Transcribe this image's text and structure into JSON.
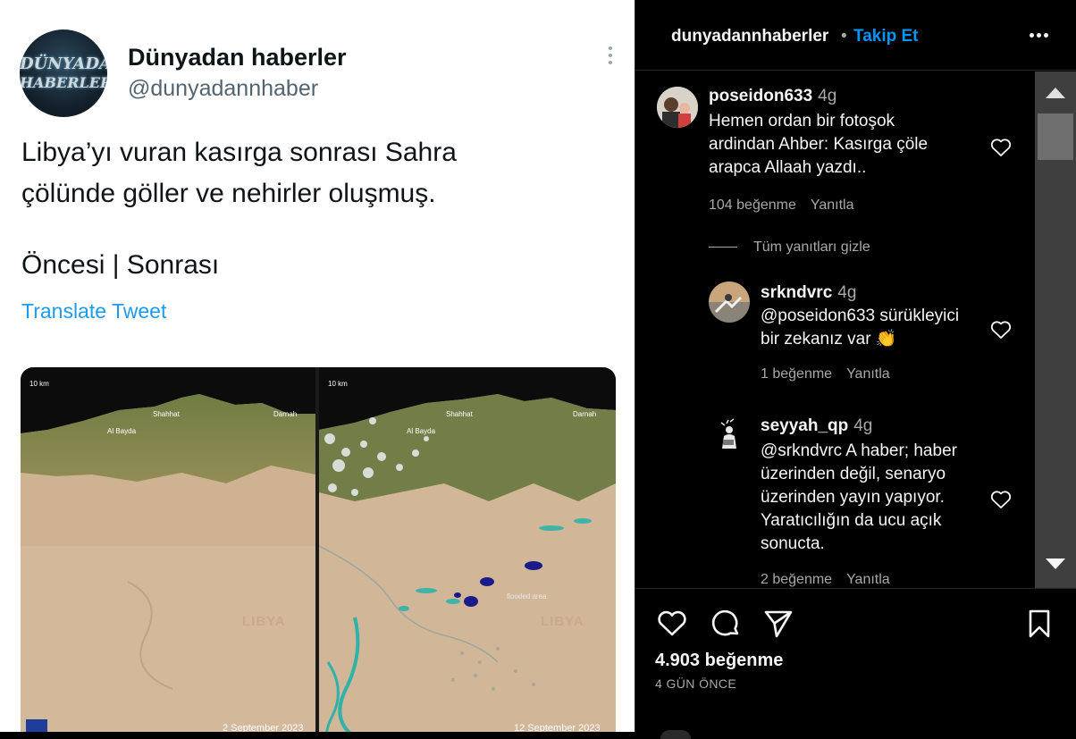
{
  "tweet": {
    "avatar_logo_line1": "DÜNYADAN",
    "avatar_logo_line2": "HABERLER",
    "name": "Dünyadan haberler",
    "handle": "@dunyadannhaber",
    "text_line1": "Libya’yı vuran kasırga sonrası Sahra",
    "text_line2": "çölünde göller ve nehirler oluşmuş.",
    "subtitle": "Öncesi | Sonrası",
    "translate_label": "Translate Tweet",
    "images": {
      "scale_label": "10 km",
      "left": {
        "city1": "Shahhat",
        "city2": "Al Bayda",
        "city3": "Darnah",
        "country": "LIBYA",
        "date": "2 September 2023"
      },
      "right": {
        "city1": "Shahhat",
        "city2": "Al Bayda",
        "city3": "Darnah",
        "country": "LIBYA",
        "date": "12 September 2023",
        "flood_label": "flooded area"
      }
    }
  },
  "instagram": {
    "header": {
      "username": "dunyadannhaberler",
      "separator": "•",
      "follow_label": "Takip Et"
    },
    "comments": [
      {
        "user": "poseidon633",
        "time": "4g",
        "lines": [
          "Hemen ordan bir fotoşok",
          "ardindan Ahber: Kasırga çöle",
          "arapca Allaah yazdı.."
        ],
        "likes": "104 beğenme",
        "reply_label": "Yanıtla"
      },
      {
        "user": "srkndvrc",
        "time": "4g",
        "lines": [
          "@poseidon633 sürükleyici",
          "bir zekanız var 👏"
        ],
        "likes": "1 beğenme",
        "reply_label": "Yanıtla"
      },
      {
        "user": "seyyah_qp",
        "time": "4g",
        "lines": [
          "@srkndvrc A haber; haber",
          "üzerinden değil, senaryo",
          "üzerinden yayın yapıyor.",
          "Yaratıcılığın da ucu açık",
          "sonucta."
        ],
        "likes": "2 beğenme",
        "reply_label": "Yanıtla"
      }
    ],
    "hide_replies_label": "Tüm yanıtları gizle",
    "likes_total": "4.903 beğenme",
    "time_ago": "4 GÜN ÖNCE",
    "colors": {
      "background": "#000000",
      "follow": "#0095f6",
      "muted": "#a8a8a8",
      "tweet_link": "#1d9bf0"
    }
  }
}
